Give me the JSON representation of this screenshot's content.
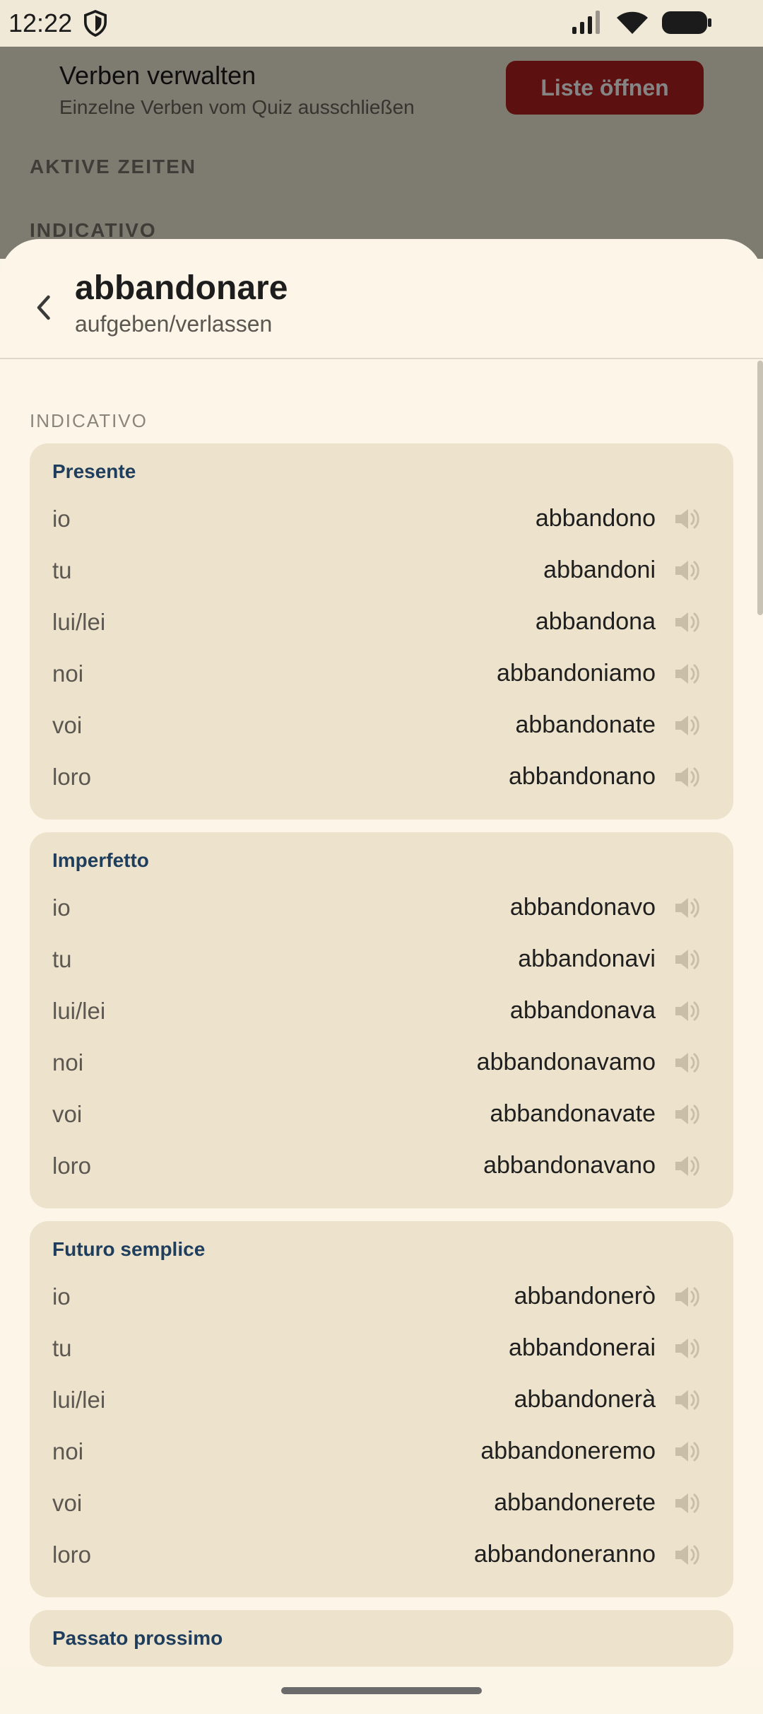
{
  "status_bar": {
    "time": "12:22"
  },
  "background": {
    "title": "Verben verwalten",
    "subtitle": "Einzelne Verben vom Quiz ausschließen",
    "button_label": "Liste öffnen",
    "section_label": "AKTIVE ZEITEN",
    "section_label_2": "INDICATIVO"
  },
  "sheet": {
    "verb": "abbandonare",
    "translation": "aufgeben/verlassen",
    "mood_label": "INDICATIVO",
    "tenses": [
      {
        "name": "Presente",
        "rows": [
          {
            "pronoun": "io",
            "form": "abbandono"
          },
          {
            "pronoun": "tu",
            "form": "abbandoni"
          },
          {
            "pronoun": "lui/lei",
            "form": "abbandona"
          },
          {
            "pronoun": "noi",
            "form": "abbandoniamo"
          },
          {
            "pronoun": "voi",
            "form": "abbandonate"
          },
          {
            "pronoun": "loro",
            "form": "abbandonano"
          }
        ]
      },
      {
        "name": "Imperfetto",
        "rows": [
          {
            "pronoun": "io",
            "form": "abbandonavo"
          },
          {
            "pronoun": "tu",
            "form": "abbandonavi"
          },
          {
            "pronoun": "lui/lei",
            "form": "abbandonava"
          },
          {
            "pronoun": "noi",
            "form": "abbandonavamo"
          },
          {
            "pronoun": "voi",
            "form": "abbandonavate"
          },
          {
            "pronoun": "loro",
            "form": "abbandonavano"
          }
        ]
      },
      {
        "name": "Futuro semplice",
        "rows": [
          {
            "pronoun": "io",
            "form": "abbandonerò"
          },
          {
            "pronoun": "tu",
            "form": "abbandonerai"
          },
          {
            "pronoun": "lui/lei",
            "form": "abbandonerà"
          },
          {
            "pronoun": "noi",
            "form": "abbandoneremo"
          },
          {
            "pronoun": "voi",
            "form": "abbandonerete"
          },
          {
            "pronoun": "loro",
            "form": "abbandoneranno"
          }
        ]
      },
      {
        "name": "Passato prossimo",
        "rows": []
      }
    ]
  },
  "colors": {
    "accent_blue": "#1f3e5e",
    "button_red": "#b21f1f",
    "card": "#ede3cc",
    "sheet": "#fdf6e8"
  }
}
